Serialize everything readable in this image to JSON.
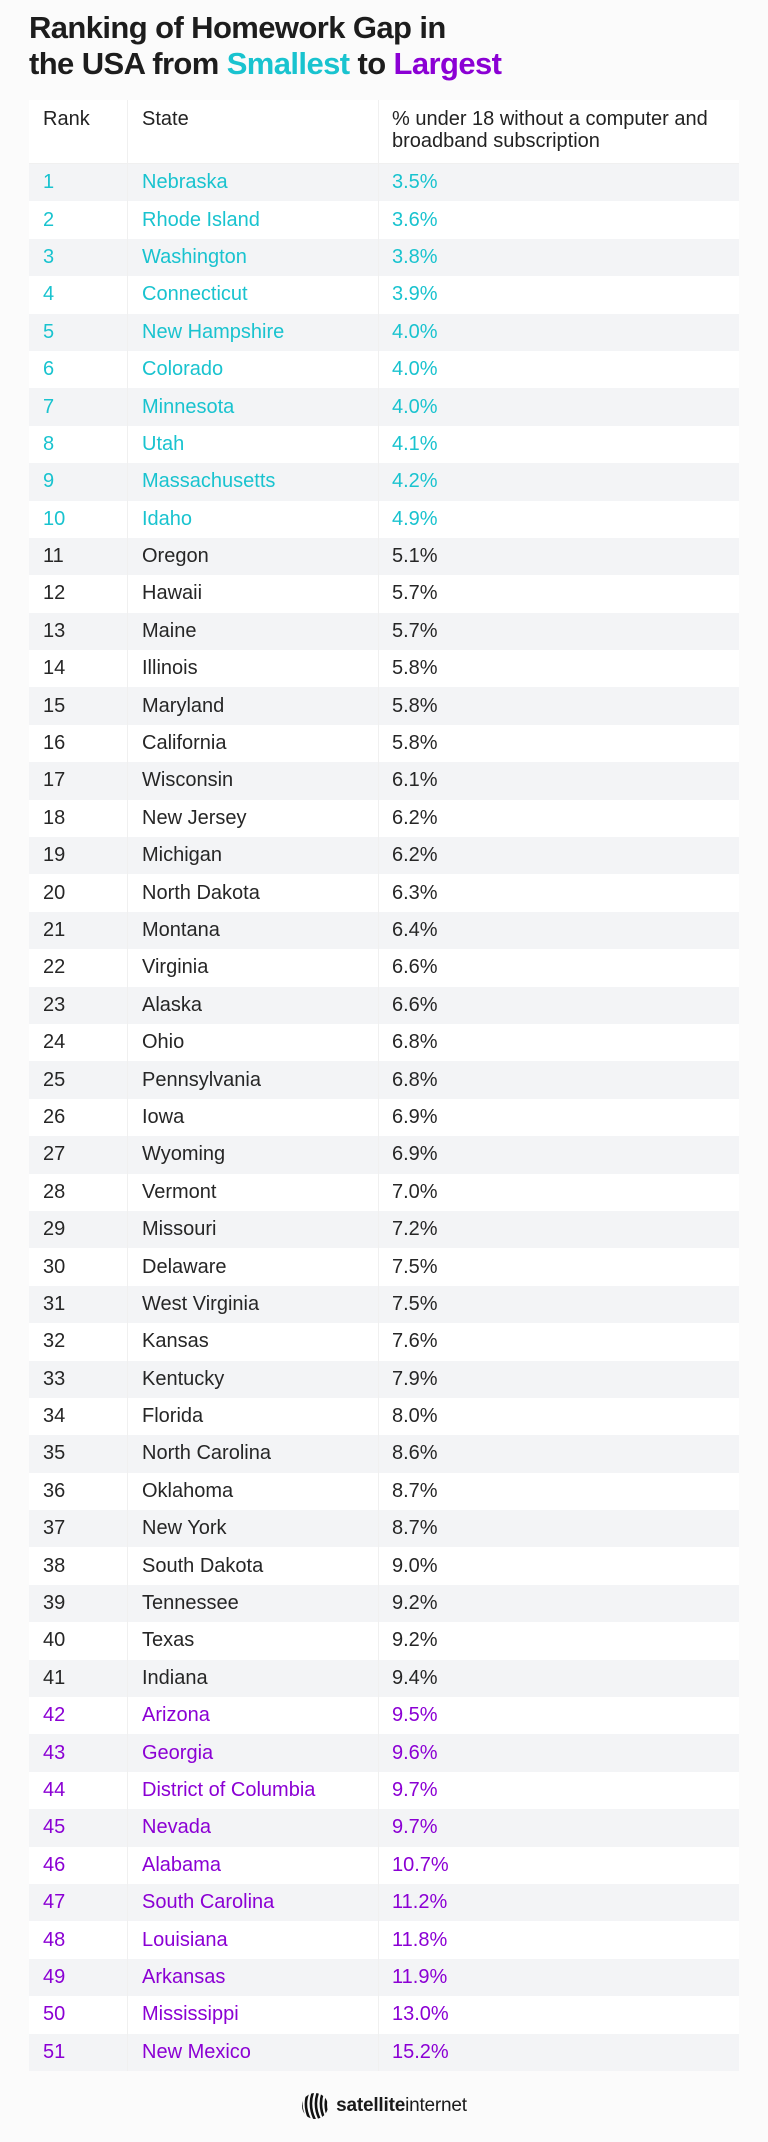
{
  "title": {
    "line1": "Ranking of Homework Gap in",
    "line2_prefix": "the USA from ",
    "highlight_small": "Smallest",
    "middle": " to ",
    "highlight_large": "Largest"
  },
  "colors": {
    "top_tier": "#19c3cf",
    "bottom_tier": "#8b00d4",
    "text": "#262626"
  },
  "table": {
    "headers": {
      "rank": "Rank",
      "state": "State",
      "pct": "% under 18 without a computer and broadband subscription"
    },
    "rows": [
      {
        "rank": "1",
        "state": "Nebraska",
        "pct": "3.5%",
        "tier": "top"
      },
      {
        "rank": "2",
        "state": "Rhode Island",
        "pct": "3.6%",
        "tier": "top"
      },
      {
        "rank": "3",
        "state": "Washington",
        "pct": "3.8%",
        "tier": "top"
      },
      {
        "rank": "4",
        "state": "Connecticut",
        "pct": "3.9%",
        "tier": "top"
      },
      {
        "rank": "5",
        "state": "New Hampshire",
        "pct": "4.0%",
        "tier": "top"
      },
      {
        "rank": "6",
        "state": "Colorado",
        "pct": "4.0%",
        "tier": "top"
      },
      {
        "rank": "7",
        "state": "Minnesota",
        "pct": "4.0%",
        "tier": "top"
      },
      {
        "rank": "8",
        "state": "Utah",
        "pct": "4.1%",
        "tier": "top"
      },
      {
        "rank": "9",
        "state": "Massachusetts",
        "pct": "4.2%",
        "tier": "top"
      },
      {
        "rank": "10",
        "state": "Idaho",
        "pct": "4.9%",
        "tier": "top"
      },
      {
        "rank": "11",
        "state": "Oregon",
        "pct": "5.1%",
        "tier": "mid"
      },
      {
        "rank": "12",
        "state": "Hawaii",
        "pct": "5.7%",
        "tier": "mid"
      },
      {
        "rank": "13",
        "state": "Maine",
        "pct": "5.7%",
        "tier": "mid"
      },
      {
        "rank": "14",
        "state": "Illinois",
        "pct": "5.8%",
        "tier": "mid"
      },
      {
        "rank": "15",
        "state": "Maryland",
        "pct": "5.8%",
        "tier": "mid"
      },
      {
        "rank": "16",
        "state": "California",
        "pct": "5.8%",
        "tier": "mid"
      },
      {
        "rank": "17",
        "state": "Wisconsin",
        "pct": "6.1%",
        "tier": "mid"
      },
      {
        "rank": "18",
        "state": "New Jersey",
        "pct": "6.2%",
        "tier": "mid"
      },
      {
        "rank": "19",
        "state": "Michigan",
        "pct": "6.2%",
        "tier": "mid"
      },
      {
        "rank": "20",
        "state": "North Dakota",
        "pct": "6.3%",
        "tier": "mid"
      },
      {
        "rank": "21",
        "state": "Montana",
        "pct": "6.4%",
        "tier": "mid"
      },
      {
        "rank": "22",
        "state": "Virginia",
        "pct": "6.6%",
        "tier": "mid"
      },
      {
        "rank": "23",
        "state": "Alaska",
        "pct": "6.6%",
        "tier": "mid"
      },
      {
        "rank": "24",
        "state": "Ohio",
        "pct": "6.8%",
        "tier": "mid"
      },
      {
        "rank": "25",
        "state": "Pennsylvania",
        "pct": "6.8%",
        "tier": "mid"
      },
      {
        "rank": "26",
        "state": "Iowa",
        "pct": "6.9%",
        "tier": "mid"
      },
      {
        "rank": "27",
        "state": "Wyoming",
        "pct": "6.9%",
        "tier": "mid"
      },
      {
        "rank": "28",
        "state": "Vermont",
        "pct": "7.0%",
        "tier": "mid"
      },
      {
        "rank": "29",
        "state": "Missouri",
        "pct": "7.2%",
        "tier": "mid"
      },
      {
        "rank": "30",
        "state": "Delaware",
        "pct": "7.5%",
        "tier": "mid"
      },
      {
        "rank": "31",
        "state": "West Virginia",
        "pct": "7.5%",
        "tier": "mid"
      },
      {
        "rank": "32",
        "state": "Kansas",
        "pct": "7.6%",
        "tier": "mid"
      },
      {
        "rank": "33",
        "state": "Kentucky",
        "pct": "7.9%",
        "tier": "mid"
      },
      {
        "rank": "34",
        "state": "Florida",
        "pct": "8.0%",
        "tier": "mid"
      },
      {
        "rank": "35",
        "state": "North Carolina",
        "pct": "8.6%",
        "tier": "mid"
      },
      {
        "rank": "36",
        "state": "Oklahoma",
        "pct": "8.7%",
        "tier": "mid"
      },
      {
        "rank": "37",
        "state": "New York",
        "pct": "8.7%",
        "tier": "mid"
      },
      {
        "rank": "38",
        "state": "South Dakota",
        "pct": "9.0%",
        "tier": "mid"
      },
      {
        "rank": "39",
        "state": "Tennessee",
        "pct": "9.2%",
        "tier": "mid"
      },
      {
        "rank": "40",
        "state": "Texas",
        "pct": "9.2%",
        "tier": "mid"
      },
      {
        "rank": "41",
        "state": "Indiana",
        "pct": "9.4%",
        "tier": "mid"
      },
      {
        "rank": "42",
        "state": "Arizona",
        "pct": "9.5%",
        "tier": "bottom"
      },
      {
        "rank": "43",
        "state": "Georgia",
        "pct": "9.6%",
        "tier": "bottom"
      },
      {
        "rank": "44",
        "state": "District of Columbia",
        "pct": "9.7%",
        "tier": "bottom"
      },
      {
        "rank": "45",
        "state": "Nevada",
        "pct": "9.7%",
        "tier": "bottom"
      },
      {
        "rank": "46",
        "state": "Alabama",
        "pct": "10.7%",
        "tier": "bottom"
      },
      {
        "rank": "47",
        "state": "South Carolina",
        "pct": "11.2%",
        "tier": "bottom"
      },
      {
        "rank": "48",
        "state": "Louisiana",
        "pct": "11.8%",
        "tier": "bottom"
      },
      {
        "rank": "49",
        "state": "Arkansas",
        "pct": "11.9%",
        "tier": "bottom"
      },
      {
        "rank": "50",
        "state": "Mississippi",
        "pct": "13.0%",
        "tier": "bottom"
      },
      {
        "rank": "51",
        "state": "New Mexico",
        "pct": "15.2%",
        "tier": "bottom"
      }
    ]
  },
  "footer": {
    "logo_icon": "satellite-globe-stripes-icon",
    "brand_bold": "satellite",
    "brand_regular": "internet"
  }
}
